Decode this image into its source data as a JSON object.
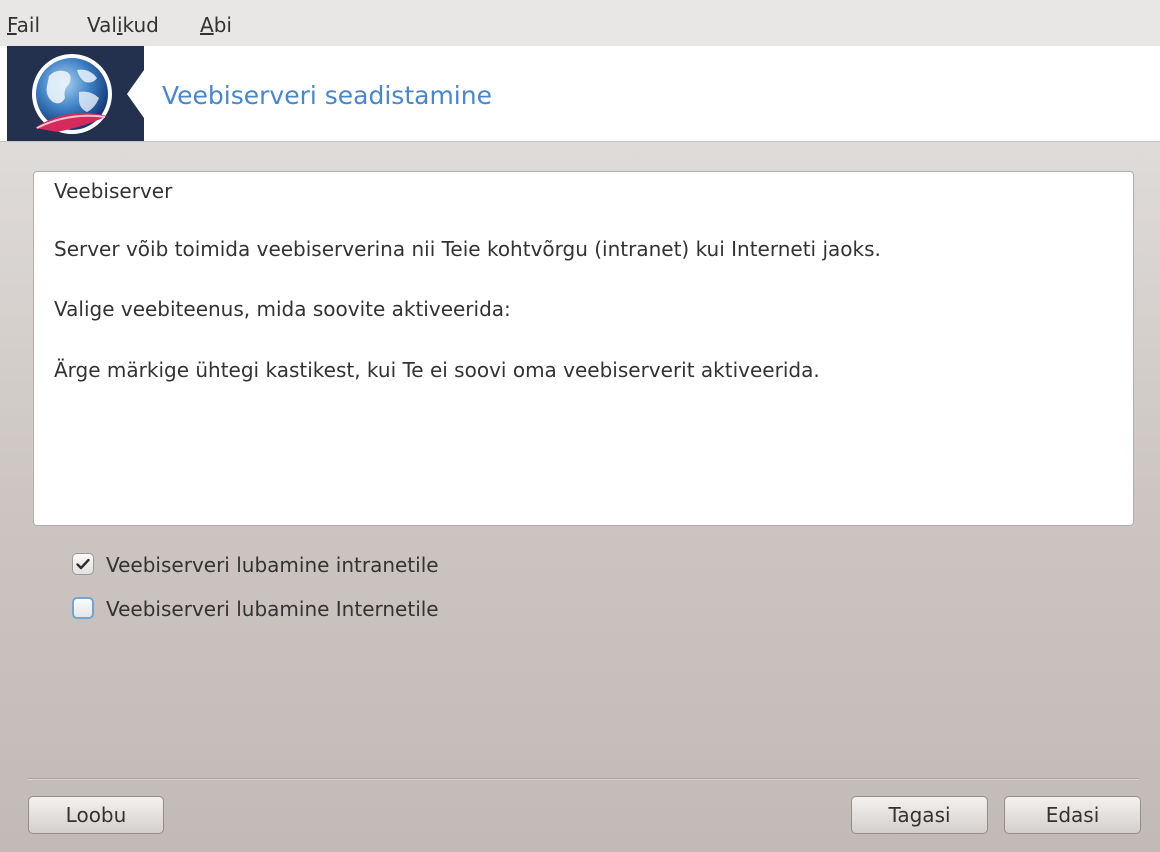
{
  "menubar": {
    "items": [
      {
        "label": "Fail",
        "mnemonic": "F",
        "rest": "ail"
      },
      {
        "label": "Valikud",
        "before": "Val",
        "mnemonic": "i",
        "after": "kud"
      },
      {
        "label": "Abi",
        "mnemonic": "A",
        "rest": "bi"
      }
    ]
  },
  "banner": {
    "title": "Veebiserveri seadistamine",
    "icon": "web-globe-feather-icon",
    "icon_bg": "#23314e",
    "title_color": "#4a86c8"
  },
  "panel": {
    "lines": [
      "Veebiserver",
      "Server võib toimida veebiserverina nii Teie kohtvõrgu (intranet) kui Interneti jaoks.",
      "Valige veebiteenus, mida soovite aktiveerida:",
      "Ärge märkige ühtegi kastikest, kui Te ei soovi oma veebiserverit aktiveerida."
    ]
  },
  "options": [
    {
      "label": "Veebiserveri lubamine intranetile",
      "checked": true
    },
    {
      "label": "Veebiserveri lubamine Internetile",
      "checked": false
    }
  ],
  "buttons": {
    "cancel": "Loobu",
    "back": "Tagasi",
    "next": "Edasi"
  }
}
